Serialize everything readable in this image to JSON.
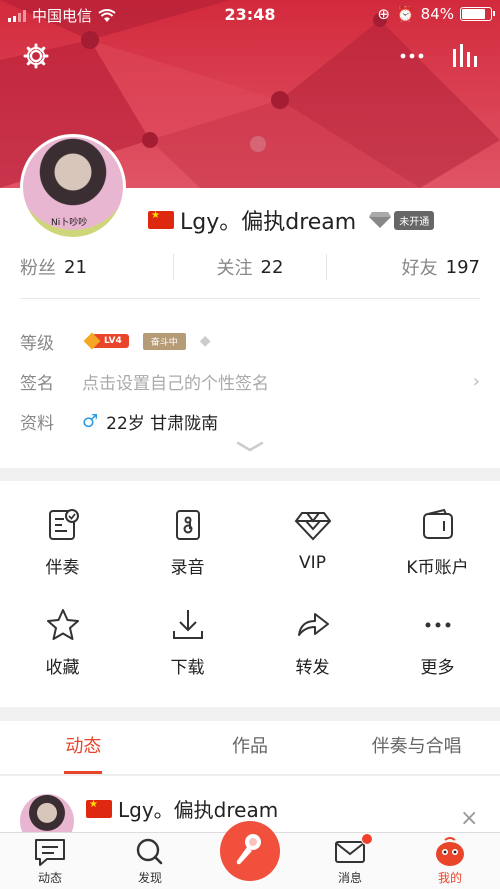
{
  "status_bar": {
    "carrier": "中国电信",
    "time": "23:48",
    "battery": "84%",
    "battery_level": 0.84
  },
  "header": {
    "settings_icon": "gear-icon",
    "more_icon": "more-dots-icon",
    "ranking_icon": "bars-icon"
  },
  "profile": {
    "name": "Lgy。偏执dream",
    "vip_status": "未开通",
    "avatar_caption": "Ni卜吵吵",
    "stats": [
      {
        "label": "粉丝",
        "value": "21"
      },
      {
        "label": "关注",
        "value": "22"
      },
      {
        "label": "好友",
        "value": "197"
      }
    ],
    "level_label": "等级",
    "level_badge": "LV4",
    "rank_badge": "奋斗中",
    "signature_label": "签名",
    "signature_placeholder": "点击设置自己的个性签名",
    "info_label": "资料",
    "info_value": "22岁 甘肃陇南"
  },
  "functions": [
    {
      "label": "伴奏",
      "icon": "accompaniment-icon"
    },
    {
      "label": "录音",
      "icon": "recording-icon"
    },
    {
      "label": "VIP",
      "icon": "vip-diamond-icon"
    },
    {
      "label": "K币账户",
      "icon": "wallet-icon"
    },
    {
      "label": "收藏",
      "icon": "star-icon"
    },
    {
      "label": "下载",
      "icon": "download-icon"
    },
    {
      "label": "转发",
      "icon": "share-icon"
    },
    {
      "label": "更多",
      "icon": "more-icon"
    }
  ],
  "tabs": [
    {
      "label": "动态",
      "active": true
    },
    {
      "label": "作品",
      "active": false
    },
    {
      "label": "伴奏与合唱",
      "active": false
    }
  ],
  "feed": {
    "name": "Lgy。偏执dream"
  },
  "bottom_nav": [
    {
      "label": "动态",
      "icon": "feed-icon"
    },
    {
      "label": "发现",
      "icon": "search-icon"
    },
    {
      "label": "",
      "icon": "sing-mic-icon"
    },
    {
      "label": "消息",
      "icon": "mail-icon"
    },
    {
      "label": "我的",
      "icon": "profile-icon"
    }
  ],
  "colors": {
    "accent": "#e8452a",
    "banner": "#c9273a"
  }
}
